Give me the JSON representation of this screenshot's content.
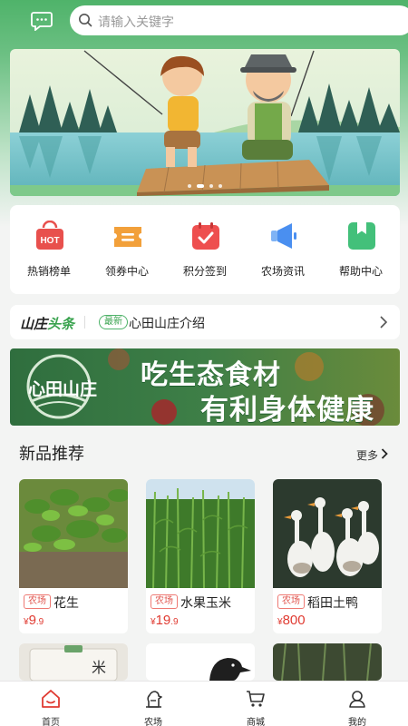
{
  "search": {
    "placeholder": "请输入关键字"
  },
  "banner": {
    "slides": 4,
    "active_index": 1
  },
  "quick_menu": [
    {
      "label": "热销榜单",
      "icon": "hot-icon",
      "badge": "HOT",
      "color": "#e8504d"
    },
    {
      "label": "领券中心",
      "icon": "coupon-icon",
      "color": "#f2a03a"
    },
    {
      "label": "积分签到",
      "icon": "calendar-check-icon",
      "color": "#ee4f4f"
    },
    {
      "label": "农场资讯",
      "icon": "megaphone-icon",
      "color": "#4a8ff0"
    },
    {
      "label": "帮助中心",
      "icon": "bookmark-icon",
      "color": "#43c07a"
    }
  ],
  "news": {
    "logo_part1": "山庄",
    "logo_part2": "头条",
    "tag": "最新",
    "headline": "心田山庄介绍"
  },
  "promo": {
    "logo_text": "心田山庄",
    "line1": "吃生态食材",
    "line2": "有利身体健康"
  },
  "new_products": {
    "title": "新品推荐",
    "more_label": "更多",
    "items": [
      {
        "tag": "农场",
        "name": "花生",
        "currency": "¥",
        "price_int": "9",
        "price_dec": ".9"
      },
      {
        "tag": "农场",
        "name": "水果玉米",
        "currency": "¥",
        "price_int": "19",
        "price_dec": ".9"
      },
      {
        "tag": "农场",
        "name": "稻田土鸭",
        "currency": "¥",
        "price_int": "800",
        "price_dec": ""
      }
    ]
  },
  "tabbar": [
    {
      "label": "首页",
      "icon": "home-icon",
      "active": true,
      "color": "#e03b32"
    },
    {
      "label": "农场",
      "icon": "farm-icon"
    },
    {
      "label": "商城",
      "icon": "cart-icon"
    },
    {
      "label": "我的",
      "icon": "user-icon"
    }
  ]
}
